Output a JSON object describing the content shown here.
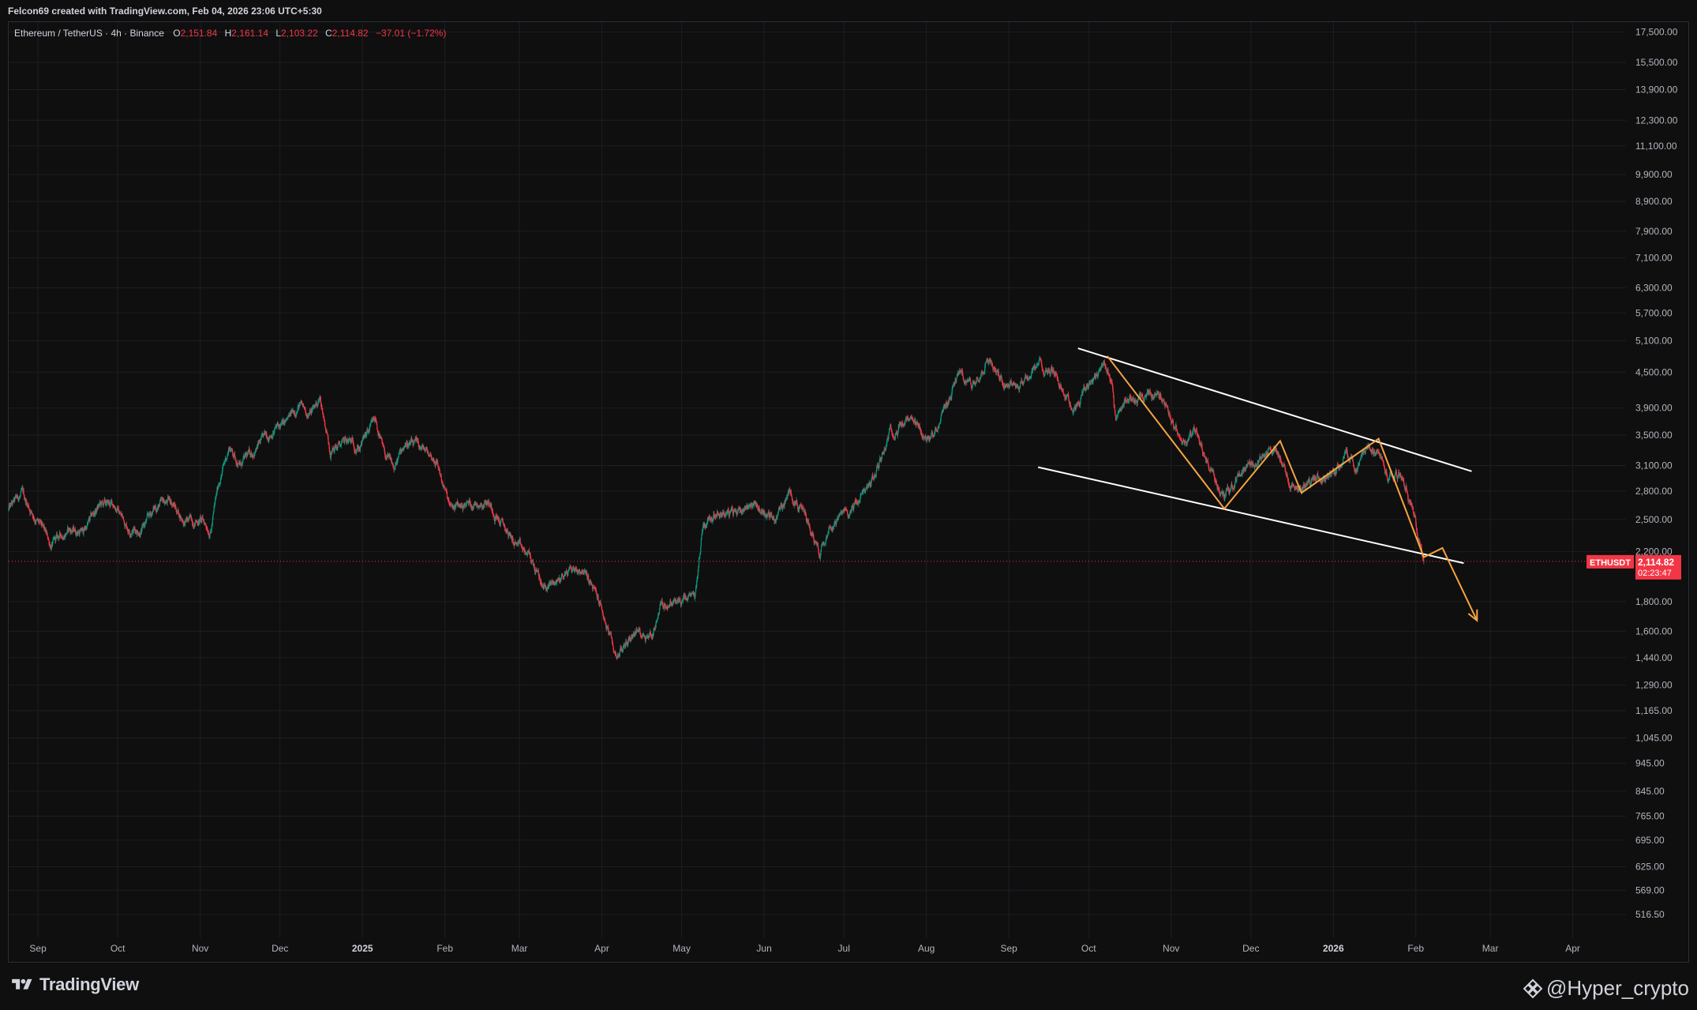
{
  "header": {
    "credit": "Felcon69 created with TradingView.com, Feb 04, 2026 23:06 UTC+5:30"
  },
  "legend": {
    "symbol": "Ethereum / TetherUS · 4h · Binance",
    "open_label": "O",
    "open": "2,151.84",
    "high_label": "H",
    "high": "2,161.14",
    "low_label": "L",
    "low": "2,103.22",
    "close_label": "C",
    "close": "2,114.82",
    "change": "−37.01 (−1.72%)"
  },
  "price_tag": {
    "symbol": "ETHUSDT",
    "price": "2,114.82",
    "countdown": "02:23:47",
    "value": 2114.82
  },
  "footer": {
    "logo_text": "TradingView",
    "watermark": "@Hyper_crypto"
  },
  "colors": {
    "up": "#089981",
    "down": "#f23645",
    "background": "#0f0f0f",
    "pattern": "#f7a440",
    "channel": "#ffffff"
  },
  "chart_data": {
    "type": "candlestick",
    "y_scale": "log",
    "ylim": [
      470,
      18200
    ],
    "y_ticks": [
      17500,
      15500,
      13900,
      12300,
      11100,
      9900,
      8900,
      7900,
      7100,
      6300,
      5700,
      5100,
      4500,
      3900,
      3500,
      3100,
      2800,
      2500,
      2200,
      1800,
      1600,
      1440,
      1290,
      1165,
      1045,
      945,
      845,
      765,
      695,
      625,
      569,
      516.5
    ],
    "y_tick_labels": [
      "17,500.00",
      "15,500.00",
      "13,900.00",
      "12,300.00",
      "11,100.00",
      "9,900.00",
      "8,900.00",
      "7,900.00",
      "7,100.00",
      "6,300.00",
      "5,700.00",
      "5,100.00",
      "4,500.00",
      "3,900.00",
      "3,500.00",
      "3,100.00",
      "2,800.00",
      "2,500.00",
      "2,200.00",
      "1,800.00",
      "1,600.00",
      "1,440.00",
      "1,290.00",
      "1,165.00",
      "1,045.00",
      "945.00",
      "845.00",
      "765.00",
      "695.00",
      "625.00",
      "569.00",
      "516.50"
    ],
    "x_range": [
      "2024-08-21",
      "2026-04-21"
    ],
    "x_ticks": [
      {
        "date": "2024-09-01",
        "label": "Sep"
      },
      {
        "date": "2024-10-01",
        "label": "Oct"
      },
      {
        "date": "2024-11-01",
        "label": "Nov"
      },
      {
        "date": "2024-12-01",
        "label": "Dec"
      },
      {
        "date": "2025-01-01",
        "label": "2025",
        "bold": true
      },
      {
        "date": "2025-02-01",
        "label": "Feb"
      },
      {
        "date": "2025-03-01",
        "label": "Mar"
      },
      {
        "date": "2025-04-01",
        "label": "Apr"
      },
      {
        "date": "2025-05-01",
        "label": "May"
      },
      {
        "date": "2025-06-01",
        "label": "Jun"
      },
      {
        "date": "2025-07-01",
        "label": "Jul"
      },
      {
        "date": "2025-08-01",
        "label": "Aug"
      },
      {
        "date": "2025-09-01",
        "label": "Sep"
      },
      {
        "date": "2025-10-01",
        "label": "Oct"
      },
      {
        "date": "2025-11-01",
        "label": "Nov"
      },
      {
        "date": "2025-12-01",
        "label": "Dec"
      },
      {
        "date": "2026-01-01",
        "label": "2026",
        "bold": true
      },
      {
        "date": "2026-02-01",
        "label": "Feb"
      },
      {
        "date": "2026-03-01",
        "label": "Mar"
      },
      {
        "date": "2026-04-01",
        "label": "Apr"
      }
    ],
    "price_path": [
      [
        "2024-08-21",
        2600
      ],
      [
        "2024-08-26",
        2760
      ],
      [
        "2024-08-31",
        2520
      ],
      [
        "2024-09-06",
        2250
      ],
      [
        "2024-09-12",
        2400
      ],
      [
        "2024-09-18",
        2380
      ],
      [
        "2024-09-24",
        2640
      ],
      [
        "2024-09-30",
        2650
      ],
      [
        "2024-10-05",
        2420
      ],
      [
        "2024-10-10",
        2400
      ],
      [
        "2024-10-15",
        2620
      ],
      [
        "2024-10-21",
        2700
      ],
      [
        "2024-10-26",
        2480
      ],
      [
        "2024-11-01",
        2500
      ],
      [
        "2024-11-05",
        2400
      ],
      [
        "2024-11-08",
        2900
      ],
      [
        "2024-11-12",
        3350
      ],
      [
        "2024-11-16",
        3100
      ],
      [
        "2024-11-24",
        3400
      ],
      [
        "2024-11-29",
        3600
      ],
      [
        "2024-12-03",
        3650
      ],
      [
        "2024-12-08",
        3950
      ],
      [
        "2024-12-12",
        3800
      ],
      [
        "2024-12-16",
        4050
      ],
      [
        "2024-12-20",
        3300
      ],
      [
        "2024-12-26",
        3400
      ],
      [
        "2024-12-31",
        3350
      ],
      [
        "2025-01-06",
        3700
      ],
      [
        "2025-01-09",
        3250
      ],
      [
        "2025-01-13",
        3050
      ],
      [
        "2025-01-17",
        3400
      ],
      [
        "2025-01-24",
        3300
      ],
      [
        "2025-01-29",
        3150
      ],
      [
        "2025-02-02",
        2700
      ],
      [
        "2025-02-03",
        2600
      ],
      [
        "2025-02-08",
        2650
      ],
      [
        "2025-02-17",
        2700
      ],
      [
        "2025-02-25",
        2350
      ],
      [
        "2025-03-02",
        2200
      ],
      [
        "2025-03-05",
        2150
      ],
      [
        "2025-03-10",
        1900
      ],
      [
        "2025-03-15",
        1950
      ],
      [
        "2025-03-20",
        2050
      ],
      [
        "2025-03-25",
        2050
      ],
      [
        "2025-03-31",
        1800
      ],
      [
        "2025-04-06",
        1450
      ],
      [
        "2025-04-09",
        1500
      ],
      [
        "2025-04-13",
        1600
      ],
      [
        "2025-04-20",
        1580
      ],
      [
        "2025-04-23",
        1780
      ],
      [
        "2025-05-01",
        1800
      ],
      [
        "2025-05-06",
        1820
      ],
      [
        "2025-05-09",
        2450
      ],
      [
        "2025-05-14",
        2600
      ],
      [
        "2025-05-20",
        2550
      ],
      [
        "2025-05-27",
        2680
      ],
      [
        "2025-06-05",
        2500
      ],
      [
        "2025-06-11",
        2800
      ],
      [
        "2025-06-17",
        2500
      ],
      [
        "2025-06-22",
        2200
      ],
      [
        "2025-06-25",
        2450
      ],
      [
        "2025-07-03",
        2580
      ],
      [
        "2025-07-09",
        2800
      ],
      [
        "2025-07-13",
        3000
      ],
      [
        "2025-07-18",
        3550
      ],
      [
        "2025-07-25",
        3700
      ],
      [
        "2025-08-02",
        3400
      ],
      [
        "2025-08-08",
        3900
      ],
      [
        "2025-08-13",
        4500
      ],
      [
        "2025-08-18",
        4250
      ],
      [
        "2025-08-24",
        4800
      ],
      [
        "2025-08-29",
        4400
      ],
      [
        "2025-09-05",
        4300
      ],
      [
        "2025-09-13",
        4650
      ],
      [
        "2025-09-18",
        4500
      ],
      [
        "2025-09-25",
        3900
      ],
      [
        "2025-10-01",
        4300
      ],
      [
        "2025-10-07",
        4700
      ],
      [
        "2025-10-10",
        4200
      ],
      [
        "2025-10-11",
        3700
      ],
      [
        "2025-10-15",
        4100
      ],
      [
        "2025-10-20",
        4000
      ],
      [
        "2025-10-28",
        4150
      ],
      [
        "2025-11-03",
        3600
      ],
      [
        "2025-11-05",
        3300
      ],
      [
        "2025-11-10",
        3550
      ],
      [
        "2025-11-15",
        3100
      ],
      [
        "2025-11-21",
        2720
      ],
      [
        "2025-11-26",
        3000
      ],
      [
        "2025-12-03",
        3150
      ],
      [
        "2025-12-10",
        3350
      ],
      [
        "2025-12-15",
        2950
      ],
      [
        "2025-12-18",
        2850
      ],
      [
        "2025-12-26",
        2950
      ],
      [
        "2026-01-01",
        3000
      ],
      [
        "2026-01-06",
        3250
      ],
      [
        "2026-01-10",
        3100
      ],
      [
        "2026-01-14",
        3350
      ],
      [
        "2026-01-18",
        3250
      ],
      [
        "2026-01-22",
        2950
      ],
      [
        "2026-01-27",
        3000
      ],
      [
        "2026-01-30",
        2700
      ],
      [
        "2026-02-02",
        2300
      ],
      [
        "2026-02-04",
        2114.82
      ]
    ],
    "current_price": 2114.82,
    "channel_lines": [
      {
        "from": [
          "2025-09-27",
          4950
        ],
        "to": [
          "2026-02-22",
          3030
        ]
      },
      {
        "from": [
          "2025-09-12",
          3080
        ],
        "to": [
          "2026-02-19",
          2100
        ]
      }
    ],
    "pattern_path": [
      [
        "2025-10-08",
        4800
      ],
      [
        "2025-11-21",
        2610
      ],
      [
        "2025-12-12",
        3420
      ],
      [
        "2025-12-20",
        2780
      ],
      [
        "2026-01-18",
        3450
      ],
      [
        "2026-02-04",
        2150
      ],
      [
        "2026-02-11",
        2230
      ],
      [
        "2026-02-24",
        1670
      ]
    ]
  }
}
